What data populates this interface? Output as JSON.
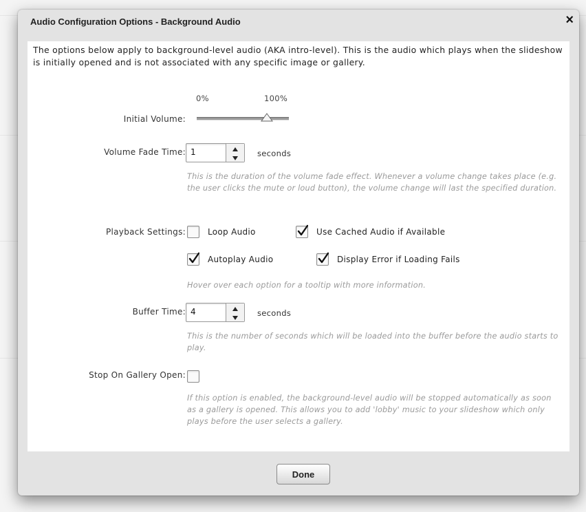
{
  "dialog": {
    "title": "Audio Configuration Options - Background Audio",
    "close_glyph": "×",
    "intro": "The options below apply to background-level audio (AKA intro-level).  This is the audio which plays when the slideshow is initially opened and is not associated with any specific image or gallery."
  },
  "initial_volume": {
    "label": "Initial Volume:",
    "min_label": "0%",
    "max_label": "100%",
    "value_fraction": 0.76
  },
  "volume_fade": {
    "label": "Volume Fade Time:",
    "value": "1",
    "unit": "seconds",
    "help": "This is the duration of the volume fade effect.  Whenever a volume change takes place (e.g. the user clicks the mute or loud button), the volume change will last the specified duration."
  },
  "playback": {
    "label": "Playback Settings:",
    "options": [
      {
        "label": "Loop Audio",
        "checked": false
      },
      {
        "label": "Use Cached Audio if Available",
        "checked": true
      },
      {
        "label": "Autoplay Audio",
        "checked": true
      },
      {
        "label": "Display Error if Loading Fails",
        "checked": true
      }
    ],
    "help": "Hover over each option for a tooltip with more information."
  },
  "buffer": {
    "label": "Buffer Time:",
    "value": "4",
    "unit": "seconds",
    "help": "This is the number of seconds which will be loaded into the buffer before the audio starts to play."
  },
  "stop_on_gallery": {
    "label": "Stop On Gallery Open:",
    "checked": false,
    "help": "If this option is enabled, the background-level audio will be stopped automatically as soon as a gallery is opened.  This allows you to add 'lobby' music to your slideshow which only plays before the user selects a gallery."
  },
  "footer": {
    "done_label": "Done"
  },
  "icons": {
    "close": "close-icon",
    "checkmark": "checkmark-icon",
    "slider_thumb": "slider-thumb-icon",
    "stepper_up": "arrow-up-icon",
    "stepper_down": "arrow-down-icon"
  }
}
